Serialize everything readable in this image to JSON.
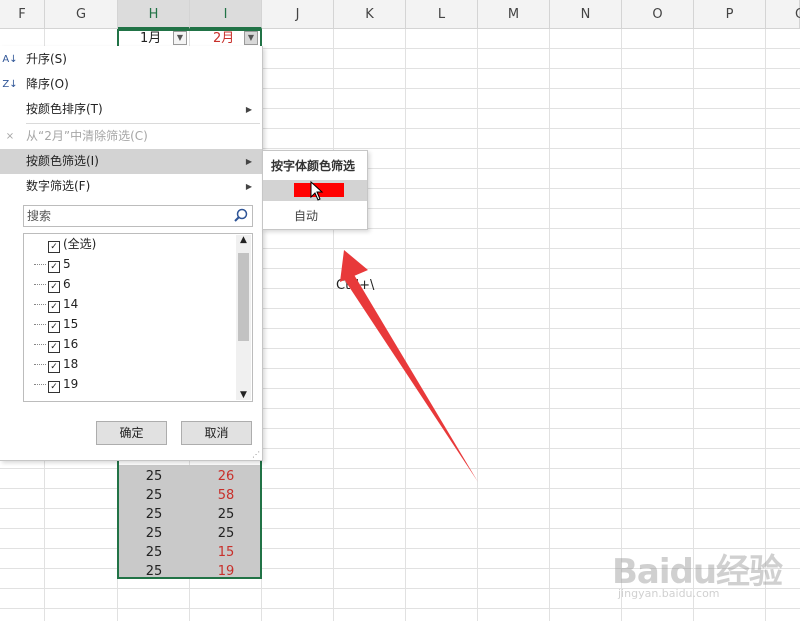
{
  "columns": [
    "F",
    "G",
    "H",
    "I",
    "J",
    "K",
    "L",
    "M",
    "N",
    "O",
    "P",
    "Q"
  ],
  "header_cells": {
    "h": "1月",
    "i": "2月"
  },
  "data_rows": [
    {
      "h": "25",
      "i": "26",
      "i_red": true
    },
    {
      "h": "25",
      "i": "58",
      "i_red": true
    },
    {
      "h": "25",
      "i": "25",
      "i_red": false
    },
    {
      "h": "25",
      "i": "25",
      "i_red": false
    },
    {
      "h": "25",
      "i": "15",
      "i_red": true
    },
    {
      "h": "25",
      "i": "19",
      "i_red": true
    }
  ],
  "menu": {
    "sort_asc": "升序(S)",
    "sort_desc": "降序(O)",
    "sort_by_color": "按颜色排序(T)",
    "clear_filter": "从“2月”中清除筛选(C)",
    "filter_by_color": "按颜色筛选(I)",
    "number_filter": "数字筛选(F)",
    "search_placeholder": "搜索",
    "list_items": [
      "(全选)",
      "5",
      "6",
      "14",
      "15",
      "16",
      "18",
      "19"
    ],
    "ok": "确定",
    "cancel": "取消"
  },
  "submenu": {
    "title": "按字体颜色筛选",
    "swatch_color": "#ff0000",
    "auto": "自动"
  },
  "cell_text": "Ctrl+\\",
  "watermark": {
    "logo": "Baidu经验",
    "url": "jingyan.baidu.com"
  },
  "colors": {
    "accent": "#217346",
    "red_text": "#c8302b",
    "annotation_arrow": "#e8393a"
  }
}
